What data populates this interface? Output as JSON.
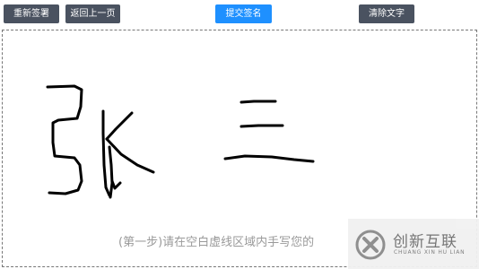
{
  "toolbar": {
    "resign_label": "重新签署",
    "back_label": "返回上一页",
    "submit_label": "提交签名",
    "clear_label": "清除文字"
  },
  "canvas": {
    "hint": "(第一步)请在空白虚线区域内手写您的",
    "signature_text": "张三"
  },
  "watermark": {
    "title": "创新互联",
    "subtitle": "CHUANG XIN HU LIAN",
    "logo_icon": "x-logo-icon"
  },
  "colors": {
    "button_dark": "#4a5260",
    "button_blue": "#1e90ff",
    "ink": "#000000",
    "hint_text": "#9a9a9a"
  }
}
